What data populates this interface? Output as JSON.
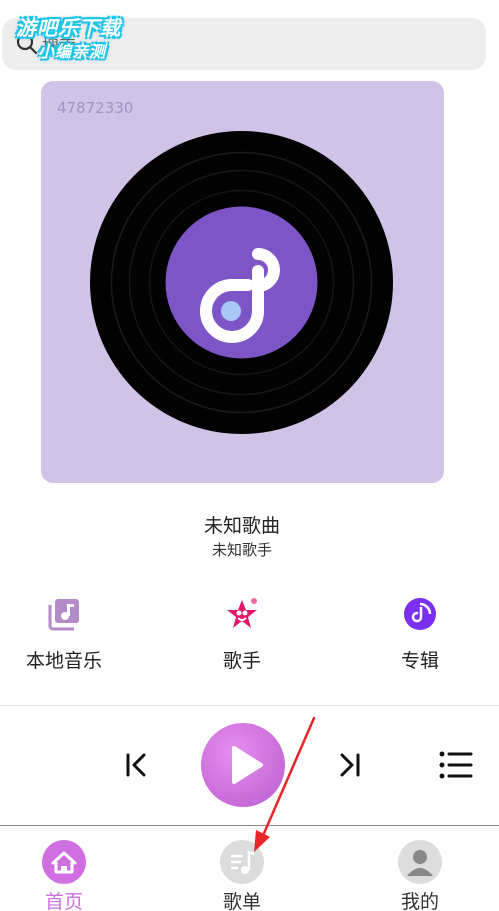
{
  "search": {
    "placeholder": "搜索"
  },
  "watermark": {
    "line1": "游吧乐下载",
    "line2": "小编亲测"
  },
  "cover": {
    "id_text": "47872330"
  },
  "now_playing": {
    "title": "未知歌曲",
    "artist": "未知歌手"
  },
  "categories": [
    {
      "label": "本地音乐",
      "icon": "local-music-icon",
      "color": "#b48ac9"
    },
    {
      "label": "歌手",
      "icon": "singer-star-icon",
      "color": "#e2196a"
    },
    {
      "label": "专辑",
      "icon": "album-disc-icon",
      "color": "#7b2ff0"
    }
  ],
  "player": {
    "play_color": "#cf74e0"
  },
  "tabs": [
    {
      "label": "首页",
      "icon": "home-icon",
      "active": true,
      "color": "#cf6fe2"
    },
    {
      "label": "歌单",
      "icon": "playlist-note-icon",
      "active": false,
      "color": "#333333"
    },
    {
      "label": "我的",
      "icon": "user-avatar-icon",
      "active": false,
      "color": "#333333"
    }
  ],
  "annotation": {
    "color": "#e8262a"
  }
}
